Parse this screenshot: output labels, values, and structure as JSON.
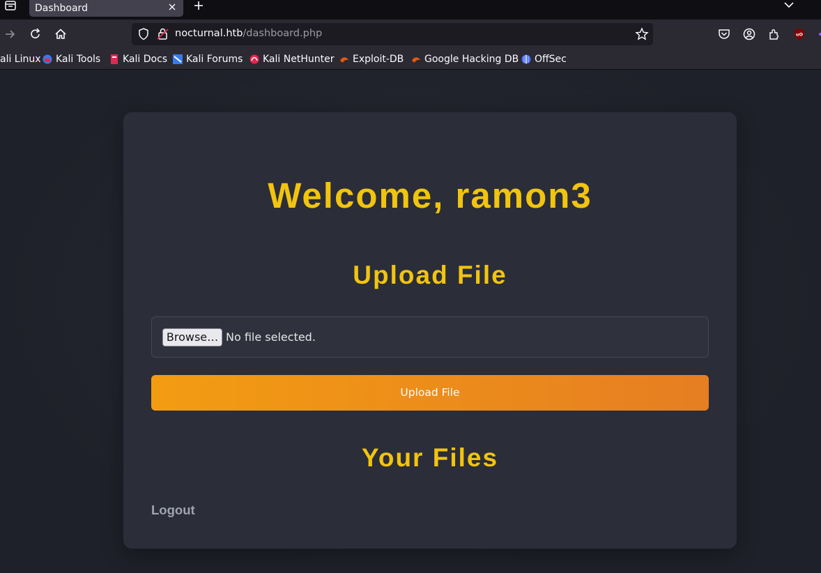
{
  "browser": {
    "tab": {
      "title": "Dashboard"
    },
    "url": {
      "host": "nocturnal.htb",
      "path": "/dashboard.php"
    },
    "bookmarks": [
      {
        "label": "ali Linux",
        "icon": "kali-linux-icon"
      },
      {
        "label": "Kali Tools",
        "icon": "kali-tools-icon"
      },
      {
        "label": "Kali Docs",
        "icon": "kali-docs-icon"
      },
      {
        "label": "Kali Forums",
        "icon": "kali-forums-icon"
      },
      {
        "label": "Kali NetHunter",
        "icon": "kali-nethunter-icon"
      },
      {
        "label": "Exploit-DB",
        "icon": "exploit-db-icon"
      },
      {
        "label": "Google Hacking DB",
        "icon": "google-hacking-db-icon"
      },
      {
        "label": "OffSec",
        "icon": "offsec-icon"
      }
    ]
  },
  "page": {
    "welcome": "Welcome, ramon3",
    "upload_heading": "Upload File",
    "file_input": {
      "button_label": "Browse…",
      "status": "No file selected."
    },
    "upload_button": "Upload File",
    "files_heading": "Your Files",
    "logout_link": "Logout"
  },
  "colors": {
    "heading": "#f1c40f",
    "button_gradient_start": "#f39c12",
    "button_gradient_end": "#e67e22",
    "card_bg": "#2b2d38",
    "page_bg": "#1f212a"
  }
}
